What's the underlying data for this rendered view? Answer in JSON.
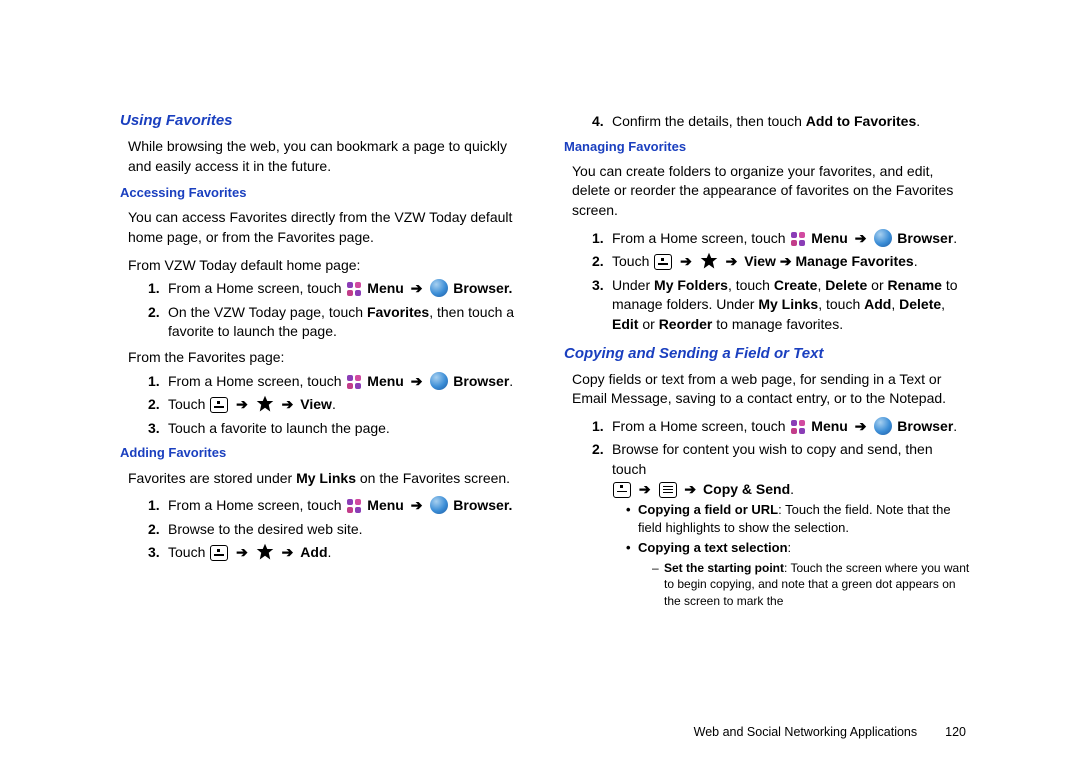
{
  "left": {
    "h1": "Using Favorites",
    "intro": "While browsing the web, you can bookmark a page to quickly and easily access it in the future.",
    "accessing_heading": "Accessing Favorites",
    "accessing_p": "You can access Favorites directly from the VZW Today default home page, or from the Favorites page.",
    "fromVZW": "From VZW Today default home page:",
    "step_homescreen": "From a Home screen, touch ",
    "menu_label": "Menu",
    "browser_label": "Browser",
    "vzw2": "On the VZW Today page, touch ",
    "favorites_word": "Favorites",
    "vzw2b": ", then touch a favorite to launch the page.",
    "fromFav": "From the Favorites page:",
    "touch_word": "Touch ",
    "view_word": "View",
    "fav_step3": "Touch a favorite to launch the page.",
    "adding_heading": "Adding Favorites",
    "adding_p1a": "Favorites are stored under ",
    "mylinks": "My Links",
    "adding_p1b": " on the Favorites screen.",
    "add_step2": "Browse to the desired web site.",
    "add_word": "Add"
  },
  "right": {
    "step4a": "Confirm the details, then touch ",
    "addtofav": "Add to Favorites",
    "managing_heading": "Managing Favorites",
    "managing_p": "You can create folders to organize your favorites, and edit, delete or reorder the appearance of favorites on the Favorites screen.",
    "manage_fav": "Manage Favorites",
    "step3a": "Under ",
    "myfolders": "My Folders",
    "step3b": ", touch ",
    "create": "Create",
    "delete": "Delete",
    "rename": "Rename",
    "step3c": " to manage folders.  Under ",
    "mylinks": "My Links",
    "step3d": ", touch ",
    "add": "Add",
    "edit": "Edit",
    "or": " or ",
    "reorder": "Reorder",
    "step3e": " to manage favorites.",
    "h2": "Copying and Sending a Field or Text",
    "copy_p": "Copy fields or text from a web page, for sending in a Text or Email Message, saving to a contact entry, or to the Notepad.",
    "copy_step2": "Browse for content you wish to copy and send, then touch",
    "copysend": "Copy & Send",
    "bullet1a": "Copying a field or URL",
    "bullet1b": ": Touch the field. Note that the field highlights to show the selection.",
    "bullet2": "Copying a text selection",
    "dash1a": "Set the starting point",
    "dash1b": ": Touch the screen where you want to begin copying, and note that a green dot appears on the screen to mark the"
  },
  "footer": {
    "chapter": "Web and Social Networking Applications",
    "page": "120"
  },
  "glyphs": {
    "arrow": "➔"
  }
}
